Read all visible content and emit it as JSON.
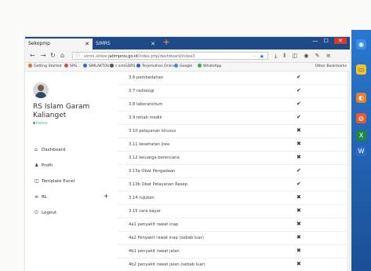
{
  "browser": {
    "tabs": [
      {
        "label": "Sekopmp",
        "active": true
      },
      {
        "label": "SIMRS",
        "active": false
      }
    ],
    "url": {
      "prefix": "simrs.sinker.",
      "host": "jatimprov.go.id",
      "path": "/index.php/dashboard/index3"
    },
    "bookmarks": [
      {
        "label": "Getting Started",
        "color": "#e8702a"
      },
      {
        "label": "SPG...",
        "color": "#e04848"
      },
      {
        "label": "SIMLAKTOU",
        "color": "#1d6fd0"
      },
      {
        "label": "c.simGDRS...",
        "color": "#555555"
      },
      {
        "label": "Terjemahan Online",
        "color": "#2a62c9"
      },
      {
        "label": "Google",
        "color": "#4285f4"
      },
      {
        "label": "WhatsApp",
        "color": "#2fb24a"
      }
    ],
    "other_bookmarks": "Other Bookmarks"
  },
  "sidebar": {
    "hospital_name_line1": "RS Islam Garam",
    "hospital_name_line2": "Kalianget",
    "status": "Online",
    "menu": [
      {
        "label": "Dashboard",
        "icon": "home-icon",
        "glyph": "⌂"
      },
      {
        "label": "Profil",
        "icon": "user-icon",
        "glyph": "♟"
      },
      {
        "label": "Template Excel",
        "icon": "file-icon",
        "glyph": "◫"
      },
      {
        "label": "RL",
        "icon": "list-icon",
        "glyph": "≡"
      },
      {
        "label": "Logout",
        "icon": "power-icon",
        "glyph": "⏻"
      }
    ],
    "expand_glyph": "+"
  },
  "main": {
    "rows": [
      {
        "label": "3.6 pembedahan",
        "mark": "✔"
      },
      {
        "label": "3.7 radiologi",
        "mark": "✔"
      },
      {
        "label": "3.8 laboratorium",
        "mark": "✔"
      },
      {
        "label": "3.9 rehab medik",
        "mark": "✔"
      },
      {
        "label": "3.10 pelayanan khusus",
        "mark": "✖"
      },
      {
        "label": "3.11 kesehatan jiwa",
        "mark": "✖"
      },
      {
        "label": "3.12 keluarga berencana",
        "mark": "✖"
      },
      {
        "label": "3.13a Obat Pengadaan",
        "mark": "✔"
      },
      {
        "label": "3.13b Obat Pelayanan Resep",
        "mark": "✔"
      },
      {
        "label": "3.14 rujukan",
        "mark": "✖"
      },
      {
        "label": "3.15 cara bayar",
        "mark": "✖"
      },
      {
        "label": "4a1 penyakit rawat inap",
        "mark": "✖"
      },
      {
        "label": "4a2 Penyakit rawat inap (sebab luar)",
        "mark": "✖"
      },
      {
        "label": "4b1 penyakit rawat jalan",
        "mark": "✖"
      },
      {
        "label": "4b2 penyakit rawat jalan (sebab luar)",
        "mark": "✖"
      }
    ]
  }
}
